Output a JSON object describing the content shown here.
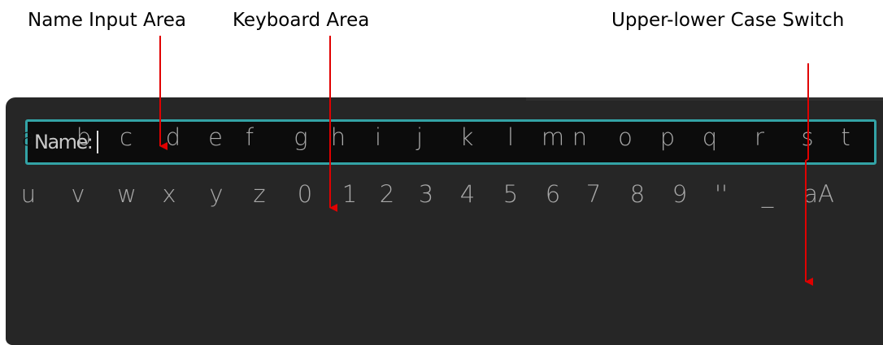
{
  "callouts": {
    "name_input": "Name Input Area",
    "keyboard": "Keyboard Area",
    "case_switch": "Upper-lower Case Switch"
  },
  "name_field": {
    "label": "Name:",
    "value": ""
  },
  "keyboard": {
    "row1": [
      "a",
      "b",
      "c",
      "d",
      "e",
      "f",
      "g",
      "h",
      "i",
      "j",
      "k",
      "l",
      "m",
      "n",
      "o",
      "p",
      "q",
      "r",
      "s",
      "t"
    ],
    "row2": [
      "u",
      "v",
      "w",
      "x",
      "y",
      "z",
      "0",
      "1",
      "2",
      "3",
      "4",
      "5",
      "6",
      "7",
      "8",
      "9",
      "''",
      "_",
      "aA"
    ],
    "selected_key": "a"
  },
  "colors": {
    "panel": "#262626",
    "field_border": "#33a3a6",
    "key_text": "#a9a9a9",
    "arrow": "#e00000"
  }
}
